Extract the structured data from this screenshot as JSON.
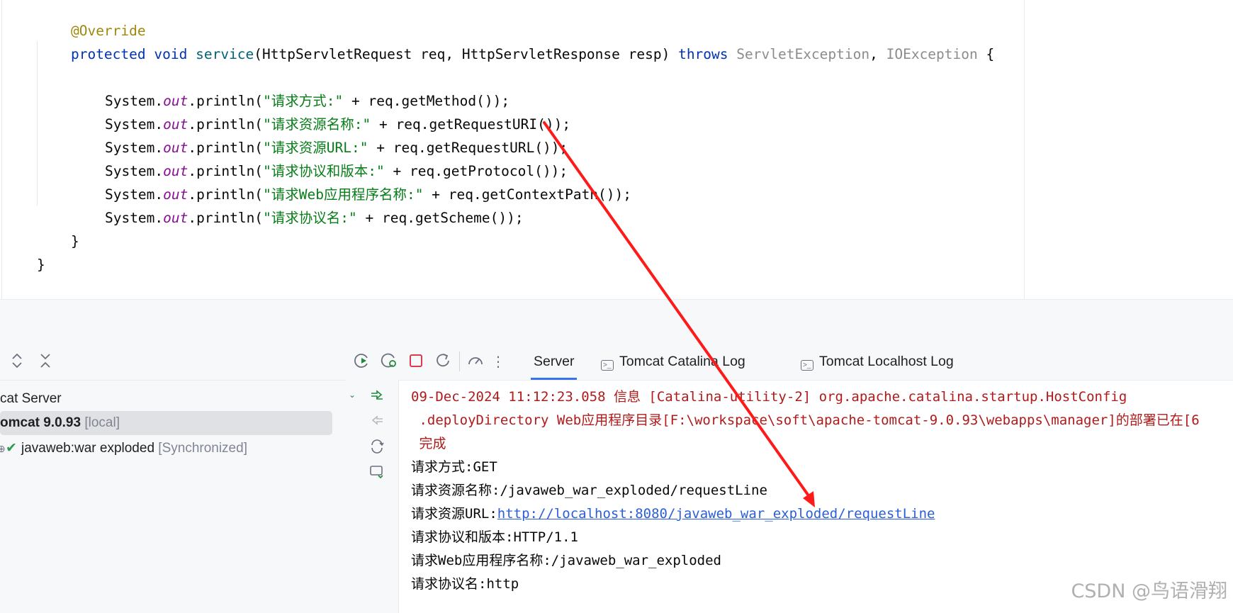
{
  "editor": {
    "annotation": "@Override",
    "signature": {
      "modifier": "protected",
      "return_type": "void",
      "method": "service",
      "open_paren": "(",
      "p1_type": "HttpServletRequest",
      "p1_name": " req, ",
      "p2_type": "HttpServletResponse",
      "p2_name": " resp) ",
      "throws": "throws",
      "ex1": " ServletException",
      "comma": ", ",
      "ex2": "IOException",
      "open_brace": " {"
    },
    "print_prefix": "System.",
    "print_field": "out",
    "print_call": ".println(",
    "statements": [
      {
        "str": "\"请求方式:\"",
        "rest": " + req.getMethod());"
      },
      {
        "str": "\"请求资源名称:\"",
        "rest": " + req.getRequestURI());"
      },
      {
        "str": "\"请求资源URL:\"",
        "rest": " + req.getRequestURL());"
      },
      {
        "str": "\"请求协议和版本:\"",
        "rest": " + req.getProtocol());"
      },
      {
        "str": "\"请求Web应用程序名称:\"",
        "rest": " + req.getContextPath());"
      },
      {
        "str": "\"请求协议名:\"",
        "rest": " + req.getScheme());"
      }
    ],
    "method_close": "}",
    "class_close": "}"
  },
  "services": {
    "expand_icon": "expand-collapse-icon",
    "close_icon": "close-all-icon",
    "tree": [
      {
        "label": "cat Server",
        "suffix": ""
      },
      {
        "label": "omcat 9.0.93",
        "suffix": " [local]"
      },
      {
        "label": "javaweb:war exploded",
        "suffix": " [Synchronized]"
      }
    ]
  },
  "console": {
    "tabs": [
      {
        "label": "Server",
        "icon": ""
      },
      {
        "label": "Tomcat Catalina Log",
        "icon": "terminal-icon"
      },
      {
        "label": "Tomcat Localhost Log",
        "icon": "terminal-icon"
      }
    ],
    "lines": {
      "log1": "09-Dec-2024 11:12:23.058 信息 [Catalina-utility-2] org.apache.catalina.startup.HostConfig",
      "log2": " .deployDirectory Web应用程序目录[F:\\workspace\\soft\\apache-tomcat-9.0.93\\webapps\\manager]的部署已在[6",
      "log3": " 完成",
      "out1": "请求方式:GET",
      "out2": "请求资源名称:/javaweb_war_exploded/requestLine",
      "out3_label": "请求资源URL:",
      "out3_link": "http://localhost:8080/javaweb_war_exploded/requestLine",
      "out4": "请求协议和版本:HTTP/1.1",
      "out5": "请求Web应用程序名称:/javaweb_war_exploded",
      "out6": "请求协议名:http"
    }
  },
  "watermark": "CSDN @鸟语滑翔",
  "colors": {
    "keyword": "#0033b3",
    "annotation": "#9e880d",
    "string": "#067d17",
    "static_field": "#871094",
    "log_error": "#b01a1a",
    "link": "#2a5fd8",
    "arrow": "#ff1a1a"
  }
}
